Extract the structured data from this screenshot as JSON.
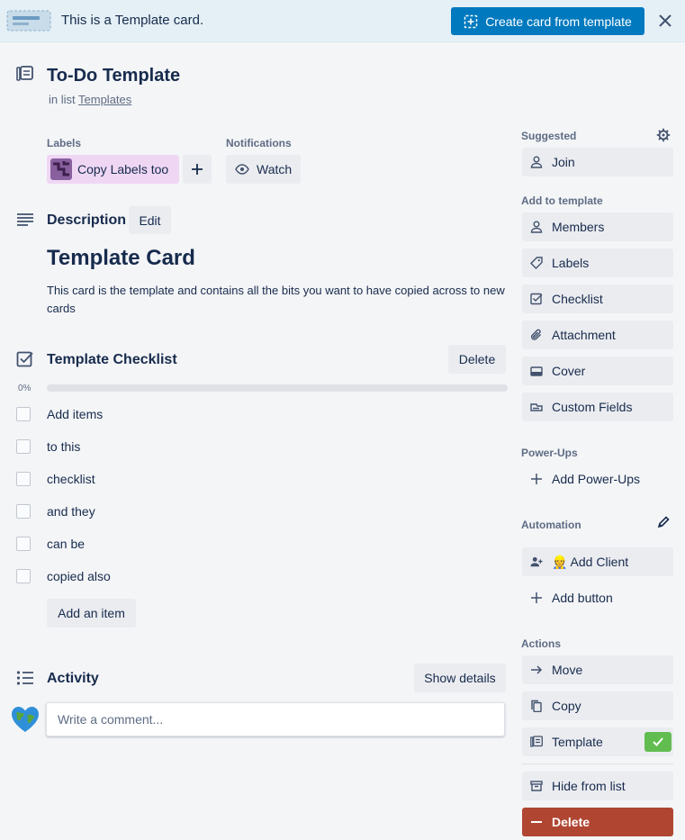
{
  "banner": {
    "text": "This is a Template card.",
    "create_button": "Create card from template"
  },
  "card": {
    "title": "To-Do Template",
    "in_list_prefix": "in list",
    "list_name": "Templates"
  },
  "labels": {
    "heading": "Labels",
    "items": [
      "Copy Labels too"
    ]
  },
  "notifications": {
    "heading": "Notifications",
    "watch_label": "Watch"
  },
  "description": {
    "title": "Description",
    "edit_label": "Edit",
    "heading": "Template Card",
    "body": "This card is the template and contains all the bits you want to have copied across to new cards"
  },
  "checklist": {
    "title": "Template Checklist",
    "delete_label": "Delete",
    "progress_text": "0%",
    "progress_fraction": 0,
    "items": [
      "Add items",
      "to this",
      "checklist",
      "and they",
      "can be",
      "copied also"
    ],
    "add_item_label": "Add an item"
  },
  "activity": {
    "title": "Activity",
    "show_details_label": "Show details",
    "comment_placeholder": "Write a comment..."
  },
  "sidebar": {
    "suggested_heading": "Suggested",
    "join_label": "Join",
    "add_to_template_heading": "Add to template",
    "add_items": [
      "Members",
      "Labels",
      "Checklist",
      "Attachment",
      "Cover",
      "Custom Fields"
    ],
    "powerups_heading": "Power-Ups",
    "add_powerups_label": "Add Power-Ups",
    "automation_heading": "Automation",
    "add_client_label": "👷 Add Client",
    "add_button_label": "Add button",
    "actions_heading": "Actions",
    "actions": [
      "Move",
      "Copy",
      "Template"
    ],
    "hide_label": "Hide from list",
    "delete_label": "Delete"
  },
  "colors": {
    "primary": "#0079bf",
    "danger": "#b04632",
    "success": "#61bd4f",
    "label_purple": "#efd7f4"
  }
}
